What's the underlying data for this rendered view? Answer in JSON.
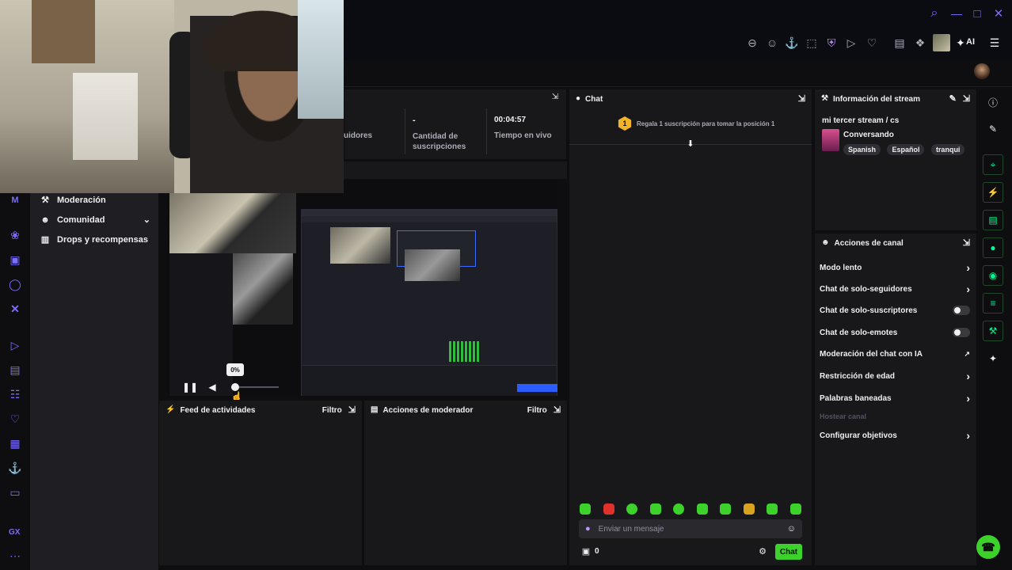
{
  "topbar": {
    "icons": [
      "search-icon",
      "minimize-icon",
      "maximize-icon",
      "close-icon"
    ],
    "toolbar_icons": [
      "zoom-out-icon",
      "emoji-icon",
      "pin-icon",
      "crop-icon",
      "shield-icon",
      "play-icon",
      "heart-icon",
      "wallet-icon",
      "puzzle-icon"
    ],
    "ai_label": "AI"
  },
  "stats": {
    "followers_label": "uidores",
    "subs_value": "-",
    "subs_label": "Cantidad de suscripciones",
    "time_value": "00:04:57",
    "time_label": "Tiempo en vivo"
  },
  "nav": {
    "moderation": "Moderación",
    "community": "Comunidad",
    "drops": "Drops y recompensas"
  },
  "preview": {
    "volume_tooltip": "0%",
    "volume_level": 0
  },
  "activity_feed": {
    "title": "Feed de actividades",
    "filter": "Filtro"
  },
  "mod_actions": {
    "title": "Acciones de moderador",
    "filter": "Filtro"
  },
  "chat": {
    "title": "Chat",
    "gift_count": "1",
    "gift_text": "Regala 1 suscripción para tomar la posición 1",
    "input_placeholder": "Enviar un mensaje",
    "points": "0",
    "send_label": "Chat"
  },
  "stream_info": {
    "title": "Información del stream",
    "stream_title": "mi tercer stream / cs",
    "category": "Conversando",
    "tags": [
      "Spanish",
      "Español",
      "tranqui"
    ]
  },
  "channel_actions": {
    "title": "Acciones de canal",
    "items": [
      {
        "label": "Modo lento",
        "control": "chevron"
      },
      {
        "label": "Chat de solo-seguidores",
        "control": "chevron"
      },
      {
        "label": "Chat de solo-suscriptores",
        "control": "toggle"
      },
      {
        "label": "Chat de solo-emotes",
        "control": "toggle"
      },
      {
        "label": "Moderación del chat con IA",
        "control": "external"
      },
      {
        "label": "Restricción de edad",
        "control": "chevron"
      },
      {
        "label": "Palabras baneadas",
        "control": "chevron"
      },
      {
        "label": "Hostear canal",
        "control": "none"
      },
      {
        "label": "Configurar objetivos",
        "control": "chevron"
      }
    ]
  },
  "left_rail": {
    "bottom_label": "GX"
  },
  "colors": {
    "accent_green": "#3cd12b",
    "brand_purple": "#9147ff",
    "gift_gold": "#f0b32a"
  }
}
